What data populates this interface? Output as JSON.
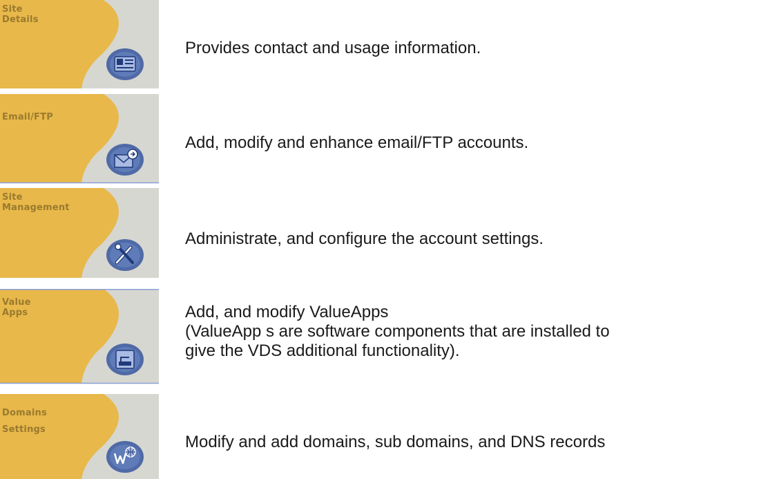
{
  "colors": {
    "gold": "#e8b84a",
    "tile_gray": "#d6d7d0",
    "icon_blue": "#4f6aa6",
    "icon_blue_light": "#a9bbe3",
    "divider_blue": "#8aa0d6",
    "label_brown": "#9a7a2e"
  },
  "items": [
    {
      "label": "Site\nDetails",
      "icon": "id-card-icon",
      "description": "Provides contact and usage information."
    },
    {
      "label": "Email/FTP",
      "icon": "email-ftp-icon",
      "description": "Add, modify and enhance email/FTP accounts."
    },
    {
      "label": "Site\nManagement",
      "icon": "tools-icon",
      "description": "Administrate, and configure the account settings."
    },
    {
      "label": "Value\nApps",
      "icon": "value-apps-icon",
      "description_lines": [
        "Add, and modify ValueApps",
        "(ValueApp s are software components that are installed to",
        "give the VDS additional functionality)."
      ]
    },
    {
      "label": "Domains\nSettings",
      "icon": "domain-globe-icon",
      "description": "Modify and add domains, sub domains, and DNS records"
    }
  ]
}
